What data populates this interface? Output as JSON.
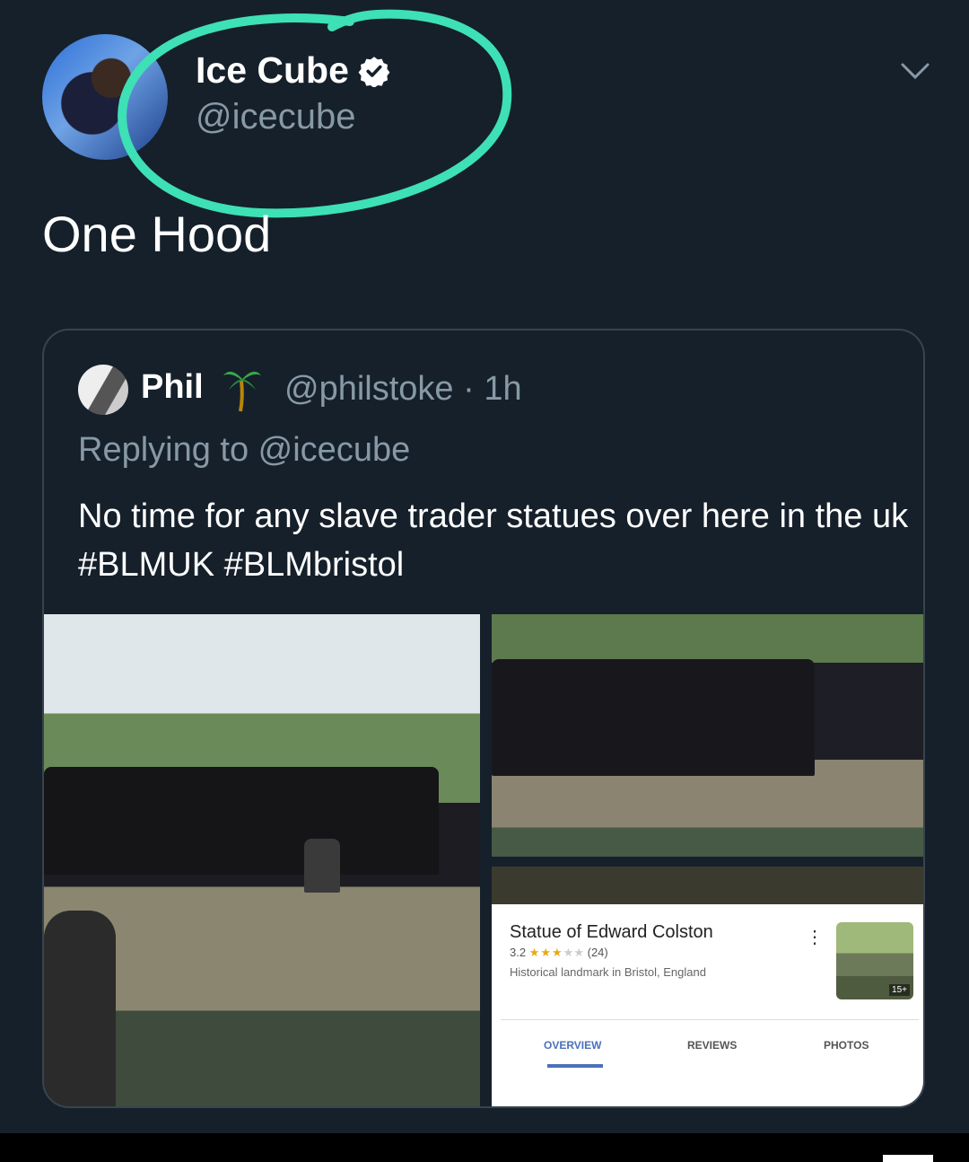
{
  "tweet": {
    "author_name": "Ice Cube",
    "author_handle": "@icecube",
    "text": "One Hood"
  },
  "quote": {
    "author_name": "Phil",
    "author_handle": "@philstoke",
    "time": "· 1h",
    "replying_to": "Replying to @icecube",
    "text": "No time for any slave trader statues over here in the uk #BLMUK #BLMbristol"
  },
  "place_card": {
    "title": "Statue of Edward Colston",
    "rating": "3.2",
    "stars": "★★★",
    "stars_empty": "★★",
    "review_count": "(24)",
    "description": "Historical landmark in Bristol, England",
    "photo_count": "15+",
    "tabs": [
      "OVERVIEW",
      "REVIEWS",
      "PHOTOS"
    ]
  },
  "colors": {
    "background": "#15202b",
    "secondary_text": "#8899a6",
    "annotation_circle": "#3ee0b5"
  },
  "icons": [
    "verified-badge-icon",
    "chevron-down-icon",
    "palm-tree-icon",
    "more-vertical-icon"
  ]
}
